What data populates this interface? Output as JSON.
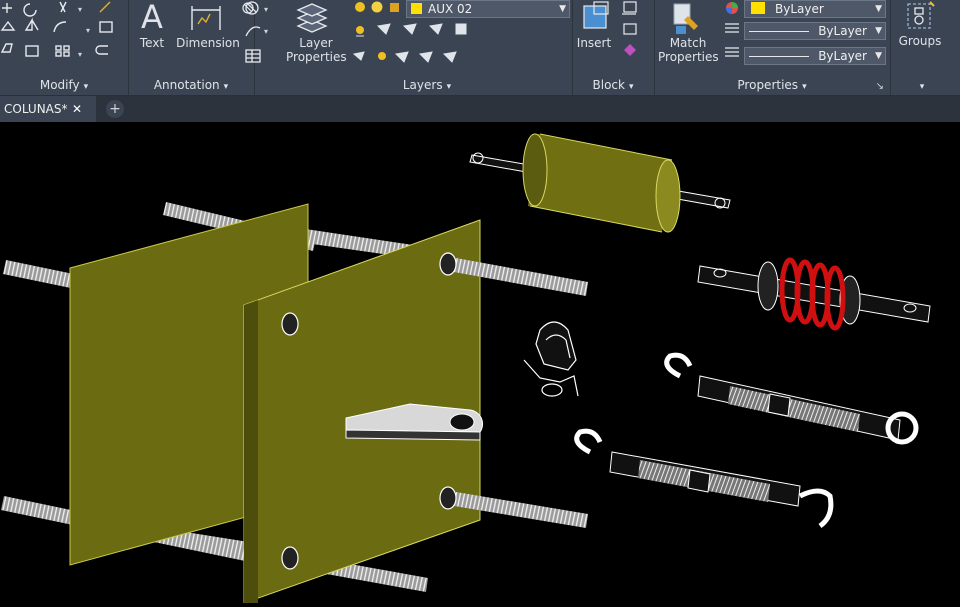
{
  "ribbon": {
    "panels": {
      "modify": "Modify",
      "annotation": "Annotation",
      "layers": "Layers",
      "block": "Block",
      "properties": "Properties"
    },
    "caret": "▾",
    "tools": {
      "text": "Text",
      "dimension": "Dimension",
      "layer_properties_line1": "Layer",
      "layer_properties_line2": "Properties",
      "insert": "Insert",
      "match_properties_line1": "Match",
      "match_properties_line2": "Properties",
      "groups": "Groups"
    },
    "layer_combo": "AUX 02",
    "color_combo": "ByLayer",
    "linetype_combo": "ByLayer",
    "lineweight_combo": "ByLayer",
    "properties_launcher": "↘"
  },
  "tabs": {
    "drawing_tab": "COLUNAS*",
    "close_glyph": "✕",
    "new_tab_glyph": "+"
  },
  "colors": {
    "ribbon_bg": "#3b4453",
    "plate_olive": "#6b6b12",
    "cylinder_olive": "#707012",
    "spring_red": "#d01010",
    "layer_yellow": "#ffe000"
  }
}
